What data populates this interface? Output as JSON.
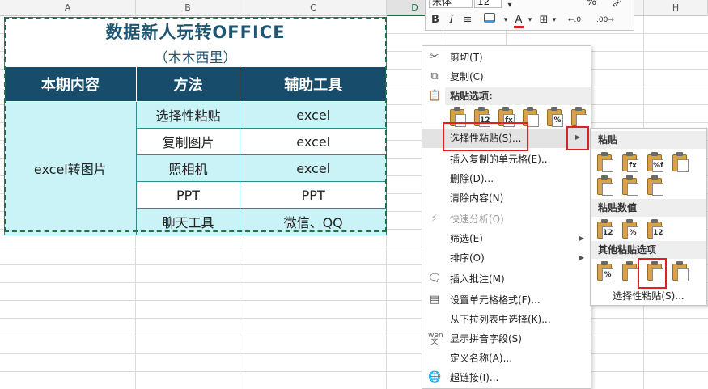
{
  "columns": {
    "a": "A",
    "b": "B",
    "c": "C",
    "d": "D",
    "h": "H"
  },
  "sheet_table": {
    "title": "数据新人玩转OFFICE",
    "subtitle": "（木木西里）",
    "headers": [
      "本期内容",
      "方法",
      "辅助工具"
    ],
    "merged_cell": "excel转图片",
    "rows": [
      {
        "method": "选择性粘贴",
        "tool": "excel"
      },
      {
        "method": "复制图片",
        "tool": "excel"
      },
      {
        "method": "照相机",
        "tool": "excel"
      },
      {
        "method": "PPT",
        "tool": "PPT"
      },
      {
        "method": "聊天工具",
        "tool": "微信、QQ"
      }
    ]
  },
  "mini_toolbar": {
    "font_name": "宋体",
    "font_size": "12",
    "bold": "B",
    "italic": "I",
    "font_color_glyph": "A",
    "percent": "%",
    "dec_increase": "←.0",
    "dec_decrease": ".00→"
  },
  "context_menu": {
    "cut": "剪切(T)",
    "copy": "复制(C)",
    "paste_options": "粘贴选项:",
    "paste_special": "选择性粘贴(S)...",
    "insert_copied": "插入复制的单元格(E)...",
    "delete": "删除(D)...",
    "clear": "清除内容(N)",
    "quick_analysis": "快速分析(Q)",
    "filter": "筛选(E)",
    "sort": "排序(O)",
    "insert_comment": "插入批注(M)",
    "format_cells": "设置单元格格式(F)...",
    "pick_list": "从下拉列表中选择(K)...",
    "phonetic": "显示拼音字段(S)",
    "define_name": "定义名称(A)...",
    "hyperlink": "超链接(I)...",
    "paste_icons": [
      "",
      "123",
      "fx",
      "",
      "%",
      ""
    ]
  },
  "submenu": {
    "paste": "粘贴",
    "paste_values": "粘贴数值",
    "other_paste": "其他粘贴选项",
    "paste_special_footer": "选择性粘贴(S)...",
    "paste_icons_row1": [
      "",
      "fx",
      "%fx",
      ""
    ],
    "paste_icons_row2": [
      "",
      "",
      ""
    ],
    "value_icons": [
      "123",
      "%",
      "123"
    ],
    "other_icons": [
      "%",
      "",
      "",
      ""
    ]
  }
}
